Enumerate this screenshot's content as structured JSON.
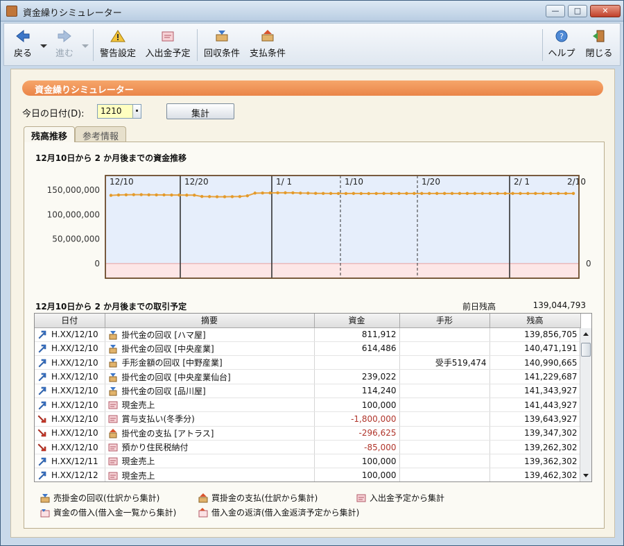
{
  "window": {
    "title": "資金繰りシミュレーター",
    "minimize_glyph": "—",
    "maximize_glyph": "□",
    "close_glyph": "✕"
  },
  "toolbar": {
    "back": "戻る",
    "forward": "進む",
    "warning_settings": "警告設定",
    "io_schedule": "入出金予定",
    "collection_terms": "回収条件",
    "payment_terms": "支払条件",
    "help": "ヘルプ",
    "close": "閉じる"
  },
  "panel": {
    "title": "資金繰りシミュレーター"
  },
  "form": {
    "date_label": "今日の日付(D):",
    "date_value": "1210",
    "sum_button": "集計"
  },
  "tabs": [
    {
      "label": "残高推移"
    },
    {
      "label": "参考情報"
    }
  ],
  "balance": {
    "title": "12月10日から 2 か月後までの資金推移"
  },
  "chart_data": {
    "type": "line",
    "title": "12月10日から 2 か月後までの資金推移",
    "y_ticks": [
      "150,000,000",
      "100,000,000",
      "50,000,000",
      "0"
    ],
    "right_tick": "0",
    "ylim": [
      -30000000,
      180000000
    ],
    "date_labels": [
      "12/10",
      "12/20",
      "1/ 1",
      "1/10",
      "1/20",
      "2/ 1",
      "2/10"
    ],
    "series": [
      {
        "values": [
          139462302,
          140200000,
          140500000,
          140800000,
          140900000,
          140500000,
          140400000,
          140300000,
          140100000,
          140100000,
          139900000,
          139800000,
          137200000,
          136900000,
          136600000,
          136600000,
          136800000,
          137000000,
          138500000,
          144000000,
          144300000,
          144400000,
          144600000,
          144700000,
          144600000,
          144100000,
          143900000,
          143600000,
          143400000,
          143300000,
          143200000,
          143200000,
          143300000,
          143200000,
          143100000,
          143200000,
          143300000,
          143300000,
          143300000,
          143300000,
          143300000,
          143300000,
          143300000,
          143300000,
          143300000,
          143300000,
          143300000,
          143300000,
          143300000,
          143300000,
          143300000,
          143300000,
          143300000,
          143300000,
          143300000,
          143300000,
          143300000,
          143300000,
          143300000,
          143300000,
          143300000,
          143300000
        ]
      }
    ],
    "grid": true,
    "colors": {
      "line": "#e8a23c",
      "point": "#e39a2a",
      "positive_bg": "#e6eefb",
      "negative_bg": "#fde6e6"
    }
  },
  "schedule": {
    "title": "12月10日から 2 か月後までの取引予定",
    "prev_label": "前日残高",
    "prev_value": "139,044,793",
    "columns": [
      "日付",
      "摘要",
      "資金",
      "手形",
      "残高"
    ],
    "rows": [
      {
        "dir": "in",
        "date": "H.XX/12/10",
        "kind": "collect",
        "desc": "掛代金の回収 [ハマ屋]",
        "fund": "811,912",
        "note": "",
        "balance": "139,856,705"
      },
      {
        "dir": "in",
        "date": "H.XX/12/10",
        "kind": "collect",
        "desc": "掛代金の回収 [中央産業]",
        "fund": "614,486",
        "note": "",
        "balance": "140,471,191"
      },
      {
        "dir": "in",
        "date": "H.XX/12/10",
        "kind": "collect",
        "desc": "手形金額の回収 [中野産業]",
        "fund": "",
        "note": "受手519,474",
        "balance": "140,990,665"
      },
      {
        "dir": "in",
        "date": "H.XX/12/10",
        "kind": "collect",
        "desc": "掛代金の回収 [中央産業仙台]",
        "fund": "239,022",
        "note": "",
        "balance": "141,229,687"
      },
      {
        "dir": "in",
        "date": "H.XX/12/10",
        "kind": "collect",
        "desc": "掛代金の回収 [品川屋]",
        "fund": "114,240",
        "note": "",
        "balance": "141,343,927"
      },
      {
        "dir": "in",
        "date": "H.XX/12/10",
        "kind": "schedule",
        "desc": "現金売上",
        "fund": "100,000",
        "note": "",
        "balance": "141,443,927"
      },
      {
        "dir": "out",
        "date": "H.XX/12/10",
        "kind": "schedule",
        "desc": "賞与支払い(冬季分)",
        "fund": "-1,800,000",
        "note": "",
        "balance": "139,643,927"
      },
      {
        "dir": "out",
        "date": "H.XX/12/10",
        "kind": "payment",
        "desc": "掛代金の支払 [アトラス]",
        "fund": "-296,625",
        "note": "",
        "balance": "139,347,302"
      },
      {
        "dir": "out",
        "date": "H.XX/12/10",
        "kind": "schedule",
        "desc": "預かり住民税納付",
        "fund": "-85,000",
        "note": "",
        "balance": "139,262,302"
      },
      {
        "dir": "in",
        "date": "H.XX/12/11",
        "kind": "schedule",
        "desc": "現金売上",
        "fund": "100,000",
        "note": "",
        "balance": "139,362,302"
      },
      {
        "dir": "in",
        "date": "H.XX/12/12",
        "kind": "schedule",
        "desc": "現金売上",
        "fund": "100,000",
        "note": "",
        "balance": "139,462,302"
      }
    ]
  },
  "legend": {
    "collect": "売掛金の回収(仕訳から集計)",
    "payment": "買掛金の支払(仕訳から集計)",
    "schedule": "入出金予定から集計",
    "borrow": "資金の借入(借入金一覧から集計)",
    "repay": "借入金の返済(借入金返済予定から集計)"
  }
}
